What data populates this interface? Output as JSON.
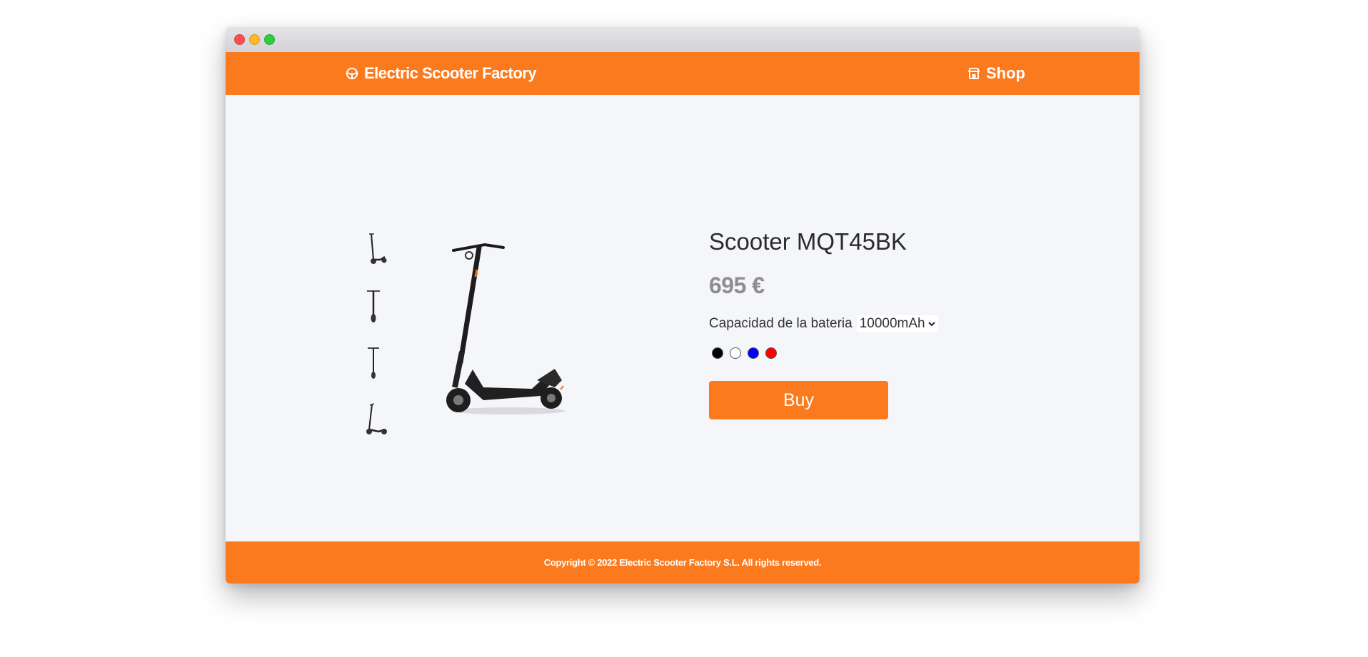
{
  "header": {
    "brand_icon": "steering-wheel-icon",
    "brand_title": "Electric Scooter Factory",
    "shop_icon": "store-icon",
    "shop_label": "Shop"
  },
  "product": {
    "title": "Scooter MQT45BK",
    "price": "695 €",
    "battery_label": "Capacidad de la bateria",
    "battery_value": "10000mAh",
    "colors": [
      "#000000",
      "#ffffff",
      "#0000ff",
      "#ff0000"
    ],
    "buy_label": "Buy"
  },
  "footer": {
    "copyright": "Copyright © 2022 Electric Scooter Factory S.L. All rights reserved."
  },
  "theme": {
    "accent": "#fc7a1e",
    "background": "#f5f6fa"
  }
}
